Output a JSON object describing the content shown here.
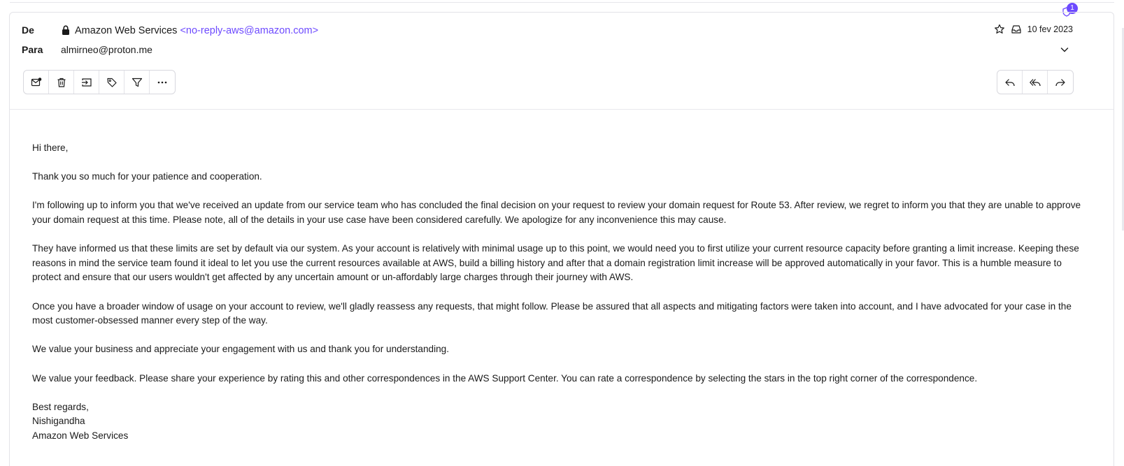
{
  "header": {
    "from_label": "De",
    "to_label": "Para",
    "sender_name": "Amazon Web Services",
    "sender_address": "<no-reply-aws@amazon.com>",
    "recipient": "almirneo@proton.me",
    "date": "10 fev 2023",
    "notification_count": "1"
  },
  "toolbar": {
    "left_icons": [
      "mark-unread-icon",
      "trash-icon",
      "move-to-folder-icon",
      "label-tag-icon",
      "filter-icon",
      "more-options-icon"
    ],
    "right_icons": [
      "reply-icon",
      "reply-all-icon",
      "forward-icon"
    ]
  },
  "message": {
    "greeting": "Hi there,",
    "p1": "Thank you so much for your patience and cooperation.",
    "p2": "I'm following up to inform you that we've received an update from our service team who has concluded the final decision on your request to review your domain request for Route 53. After review, we regret to inform you that they are unable to approve your domain request at this time. Please note, all of the details in your use case have been considered carefully. We apologize for any inconvenience this may cause.",
    "p3": "They have informed us that these limits are set by default via our system. As your account is relatively with minimal usage up to this point, we would need you to first utilize your current resource capacity before granting a limit increase. Keeping these reasons in mind the service team found it ideal to let you use the current resources available at AWS, build a billing history and after that a domain registration limit increase will be approved automatically in your favor. This is a humble measure to protect and ensure that our users wouldn't get affected by any uncertain amount or un-affordably large charges through their journey with AWS.",
    "p4": "Once you have a broader window of usage on your account to review, we'll gladly reassess any requests, that might follow. Please be assured that all aspects and mitigating factors were taken into account, and I have advocated for your case in the most customer-obsessed manner every step of the way.",
    "p5": "We value your business and appreciate your engagement with us and thank you for understanding.",
    "p6": "We value your feedback. Please share your experience by rating this and other correspondences in the AWS Support Center. You can rate a correspondence by selecting the stars in the top right corner of the correspondence.",
    "closing": "Best regards,",
    "signature_name": "Nishigandha",
    "signature_company": "Amazon Web Services"
  },
  "colors": {
    "accent": "#6d4aff",
    "text": "#1a1a1a",
    "border": "#d8d8de"
  }
}
